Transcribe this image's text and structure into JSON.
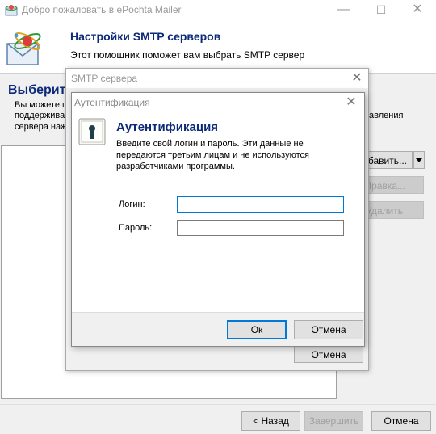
{
  "main_window": {
    "title": "Добро пожаловать в ePochta Mailer",
    "controls": {
      "minimize": "—",
      "maximize": "☐",
      "close": "✕"
    },
    "header": {
      "title": "Настройки SMTP серверов",
      "subtitle": "Этот помощник поможет вам выбрать SMTP сервер"
    },
    "step": {
      "heading": "Выберите",
      "desc_line1": "Вы можете п",
      "desc_line2": "поддержива",
      "desc_line3": "сервера наж",
      "desc_right": "авления"
    },
    "side_buttons": {
      "add": "бавить...",
      "edit": "Правка...",
      "delete": "Удалить"
    },
    "footer": {
      "back": "< Назад",
      "finish": "Завершить",
      "cancel": "Отмена"
    }
  },
  "smtp_dialog": {
    "title": "SMTP сервера",
    "cancel": "Отмена"
  },
  "auth_dialog": {
    "title": "Аутентификация",
    "heading": "Аутентификация",
    "desc_line1": "Введите свой логин и пароль. Эти данные не",
    "desc_line2": "передаются третьим лицам и не используются",
    "desc_line3": "разработчиками программы.",
    "login_label": "Логин:",
    "password_label": "Пароль:",
    "login_value": "",
    "password_value": "",
    "ok": "Ок",
    "cancel": "Отмена"
  },
  "colors": {
    "heading": "#0c2a79",
    "focus": "#0078d7"
  }
}
